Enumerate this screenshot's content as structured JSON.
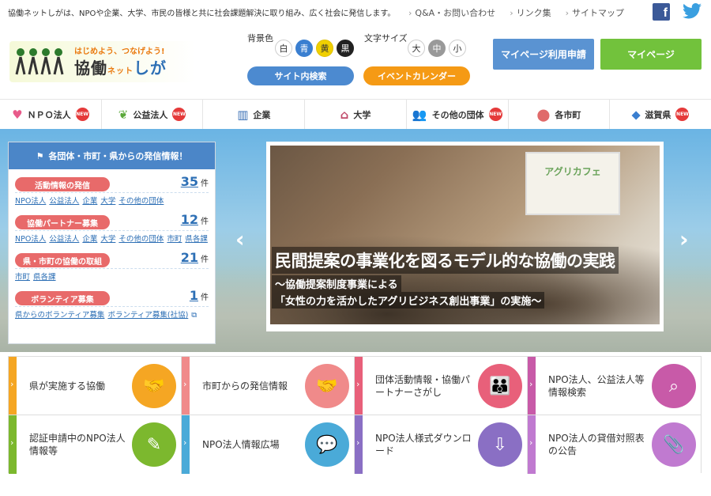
{
  "topbar": {
    "tagline": "協働ネットしがは、NPOや企業、大学、市民の皆様と共に社会課題解決に取り組み、広く社会に発信します。",
    "links": [
      "Q&A・お問い合わせ",
      "リンク集",
      "サイトマップ"
    ]
  },
  "logo": {
    "catch": "はじめよう、つなげよう!",
    "main": "協働",
    "net": "ネット",
    "shiga": "しが"
  },
  "options": {
    "bg_label": "背景色",
    "bg_colors": [
      "白",
      "青",
      "黄",
      "黒"
    ],
    "size_label": "文字サイズ",
    "sizes": [
      "大",
      "中",
      "小"
    ]
  },
  "buttons": {
    "site_search": "サイト内検索",
    "event_calendar": "イベントカレンダー",
    "mypage_apply": "マイページ利用申請",
    "mypage": "マイページ"
  },
  "nav": [
    {
      "label": "ＮＰＯ法人",
      "new": true
    },
    {
      "label": "公益法人",
      "new": true
    },
    {
      "label": "企業",
      "new": false
    },
    {
      "label": "大学",
      "new": false
    },
    {
      "label": "その他の団体",
      "new": true
    },
    {
      "label": "各市町",
      "new": false
    },
    {
      "label": "滋賀県",
      "new": true
    }
  ],
  "new_badge": "NEW",
  "info": {
    "heading": "各団体・市町・県からの発信情報！",
    "sections": [
      {
        "tag": "活動情報の発信",
        "count": "35",
        "unit": "件",
        "links": [
          "NPO法人",
          "公益法人",
          "企業",
          "大学",
          "その他の団体"
        ]
      },
      {
        "tag": "協働パートナー募集",
        "count": "12",
        "unit": "件",
        "links": [
          "NPO法人",
          "公益法人",
          "企業",
          "大学",
          "その他の団体",
          "市町",
          "県各課"
        ]
      },
      {
        "tag": "県・市町の協働の取組",
        "count": "21",
        "unit": "件",
        "links": [
          "市町",
          "県各課"
        ]
      },
      {
        "tag": "ボランティア募集",
        "count": "1",
        "unit": "件",
        "links": [
          "県からのボランティア募集",
          "ボランティア募集(社協)"
        ]
      }
    ]
  },
  "slide": {
    "screen_text": "アグリカフェ",
    "title": "民間提案の事業化を図るモデル的な協働の実践",
    "sub1": "～協働提案制度事業による",
    "sub2": "「女性の力を活かしたアグリビジネス創出事業」の実施～"
  },
  "tiles": [
    {
      "text": "県が実施する協働",
      "color": "#f5a623"
    },
    {
      "text": "市町からの発信情報",
      "color": "#f08a8a"
    },
    {
      "text": "団体活動情報・協働パートナーさがし",
      "color": "#e8607a"
    },
    {
      "text": "NPO法人、公益法人等情報検索",
      "color": "#c85aa8"
    },
    {
      "text": "認証申請中のNPO法人情報等",
      "color": "#7cb82e"
    },
    {
      "text": "NPO法人情報広場",
      "color": "#4aaad8"
    },
    {
      "text": "NPO法人様式ダウンロード",
      "color": "#8a6fc4"
    },
    {
      "text": "NPO法人の貸借対照表の公告",
      "color": "#c07ad0"
    }
  ]
}
